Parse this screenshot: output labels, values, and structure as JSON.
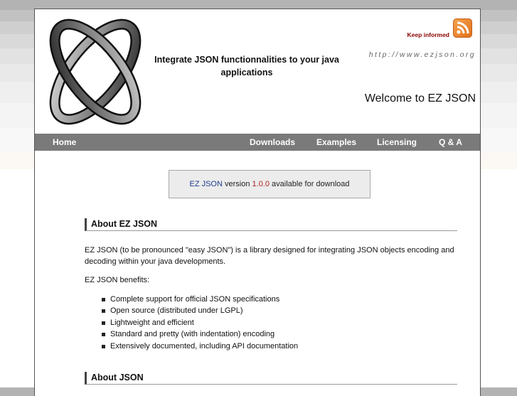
{
  "header": {
    "tagline": "Integrate JSON functionnalities to your java applications",
    "keep_informed": "Keep informed",
    "url": "http://www.ezjson.org",
    "welcome": "Welcome to EZ JSON"
  },
  "nav": {
    "home": "Home",
    "downloads": "Downloads",
    "examples": "Examples",
    "licensing": "Licensing",
    "qa": "Q & A"
  },
  "notice": {
    "product": "EZ JSON",
    "pre_version": " version ",
    "version": "1.0.0",
    "post_version": " available for download"
  },
  "about_ez": {
    "heading": "About EZ JSON",
    "intro": "EZ JSON (to be pronounced \"easy JSON\") is a library designed for integrating JSON objects encoding and decoding within your java developments.",
    "benefits_title": "EZ JSON benefits:",
    "benefits": [
      "Complete support for official JSON specifications",
      "Open source (distributed under LGPL)",
      "Lightweight and efficient",
      "Standard and pretty (with indentation) encoding",
      "Extensively documented, including API documentation"
    ]
  },
  "about_json": {
    "heading": "About JSON"
  },
  "icons": {
    "logo": "ez-json-logo",
    "rss": "rss-feed-icon"
  },
  "colors": {
    "nav_bg": "#7a7a7a",
    "keep_informed": "#8b0000",
    "version": "#b22222",
    "link": "#1e3d8f",
    "rss": "#f28c28"
  }
}
